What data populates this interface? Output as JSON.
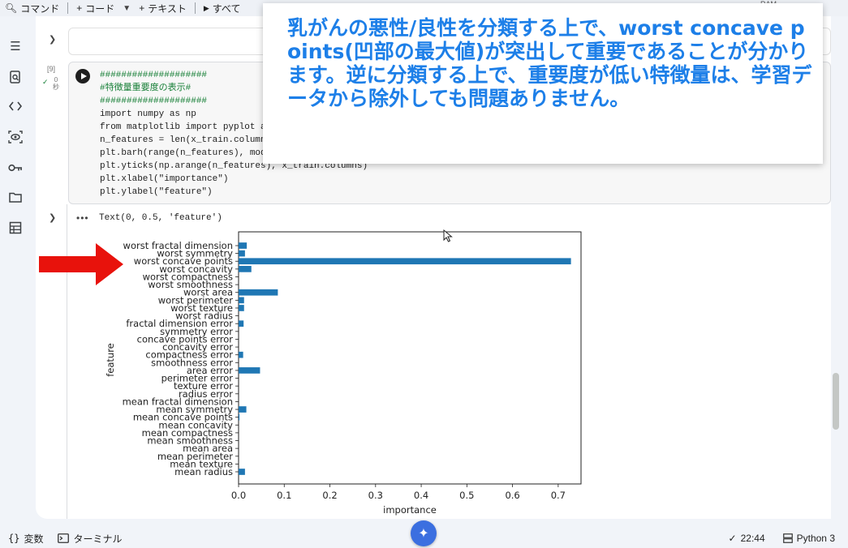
{
  "toolbar": {
    "command": "コマンド",
    "add_code": "コード",
    "add_text": "テキスト",
    "run_all": "すべて",
    "ram": "RAM"
  },
  "cell": {
    "exec_count": "[9]",
    "exec_time": "0秒",
    "code_lines": [
      {
        "cls": "cm",
        "text": "####################"
      },
      {
        "cls": "cm",
        "text": "#特徴量重要度の表示#"
      },
      {
        "cls": "cm",
        "text": "####################"
      },
      {
        "cls": "plain",
        "text": "import numpy as np"
      },
      {
        "cls": "plain",
        "text": "from matplotlib import pyplot as p"
      },
      {
        "cls": "plain",
        "text": "n_features = len(x_train.columns)"
      },
      {
        "cls": "plain",
        "text": "plt.barh(range(n_features), model."
      },
      {
        "cls": "plain",
        "text": "plt.yticks(np.arange(n_features), x_train.columns)"
      },
      {
        "cls": "plain",
        "text": "plt.xlabel(\"importance\")"
      },
      {
        "cls": "plain",
        "text": "plt.ylabel(\"feature\")"
      }
    ]
  },
  "output": {
    "dots": "•••",
    "text": "Text(0, 0.5, 'feature')"
  },
  "callout": {
    "text": "乳がんの悪性/良性を分類する上で、worst concave points(凹部の最大値)が突出して重要であることが分かります。逆に分類する上で、重要度が低い特徴量は、学習データから除外しても問題ありません。"
  },
  "statusbar": {
    "variables": "変数",
    "terminal": "ターミナル",
    "time": "22:44",
    "runtime": "Python 3"
  },
  "colors": {
    "bar": "#1f77b4",
    "arrow": "#e8120c",
    "callout_text": "#1d7fe8"
  },
  "chart_data": {
    "type": "bar",
    "orientation": "horizontal",
    "xlabel": "importance",
    "ylabel": "feature",
    "xlim": [
      0,
      0.75
    ],
    "xticks": [
      "0.0",
      "0.1",
      "0.2",
      "0.3",
      "0.4",
      "0.5",
      "0.6",
      "0.7"
    ],
    "categories": [
      "mean radius",
      "mean texture",
      "mean perimeter",
      "mean area",
      "mean smoothness",
      "mean compactness",
      "mean concavity",
      "mean concave points",
      "mean symmetry",
      "mean fractal dimension",
      "radius error",
      "texture error",
      "perimeter error",
      "area error",
      "smoothness error",
      "compactness error",
      "concavity error",
      "concave points error",
      "symmetry error",
      "fractal dimension error",
      "worst radius",
      "worst texture",
      "worst perimeter",
      "worst area",
      "worst smoothness",
      "worst compactness",
      "worst concavity",
      "worst concave points",
      "worst symmetry",
      "worst fractal dimension"
    ],
    "values": [
      0.014,
      0.0,
      0.0,
      0.0,
      0.0,
      0.0,
      0.0,
      0.002,
      0.017,
      0.0,
      0.0,
      0.0,
      0.0,
      0.047,
      0.0,
      0.01,
      0.0,
      0.0,
      0.0,
      0.011,
      0.0,
      0.012,
      0.012,
      0.086,
      0.0,
      0.0,
      0.028,
      0.728,
      0.014,
      0.018
    ],
    "grid": false
  }
}
